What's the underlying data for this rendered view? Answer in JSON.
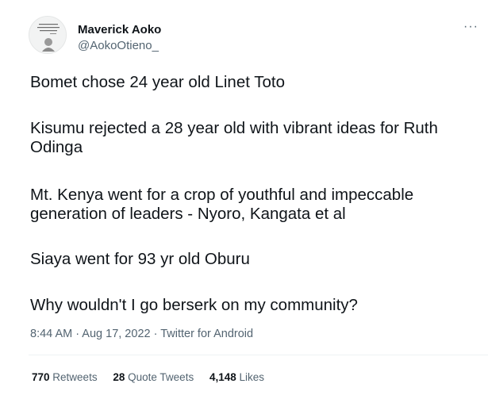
{
  "author": {
    "name": "Maverick Aoko",
    "handle": "@AokoOtieno_"
  },
  "more_icon": "more-icon",
  "tweet": {
    "paragraphs": [
      "Bomet chose 24 year old Linet Toto",
      "Kisumu rejected a 28 year old with vibrant ideas for Ruth Odinga",
      "Mt. Kenya went for a crop of youthful and impeccable generation of leaders - Nyoro, Kangata et al",
      "Siaya went for 93 yr old Oburu",
      "Why wouldn't I go berserk on my community?"
    ],
    "time": "8:44 AM",
    "sep1": " · ",
    "date": "Aug 17, 2022",
    "sep2": " · ",
    "source": "Twitter for Android"
  },
  "stats": {
    "retweets_count": "770",
    "retweets_label": "Retweets",
    "quotes_count": "28",
    "quotes_label": "Quote Tweets",
    "likes_count": "4,148",
    "likes_label": "Likes"
  }
}
